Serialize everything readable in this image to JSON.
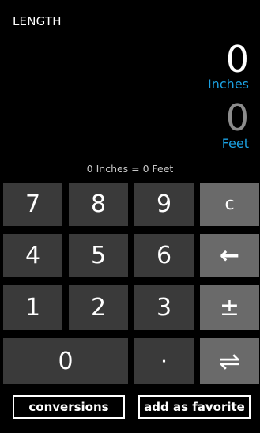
{
  "header": {
    "title": "LENGTH"
  },
  "display": {
    "primary_value": "0",
    "primary_unit": "Inches",
    "secondary_value": "0",
    "secondary_unit": "Feet",
    "summary": "0 Inches = 0 Feet"
  },
  "keypad": {
    "k7": "7",
    "k8": "8",
    "k9": "9",
    "k4": "4",
    "k5": "5",
    "k6": "6",
    "k1": "1",
    "k2": "2",
    "k3": "3",
    "k0": "0",
    "decimal": "·",
    "clear": "c",
    "backspace": "←",
    "plus_minus": "±",
    "swap": "⇌"
  },
  "actions": {
    "conversions_label": "conversions",
    "favorite_label": "add as favorite"
  },
  "colors": {
    "accent": "#1ba1e2",
    "number_key": "#3a3a3a",
    "operator_key": "#6a6a6a",
    "background": "#000000"
  }
}
